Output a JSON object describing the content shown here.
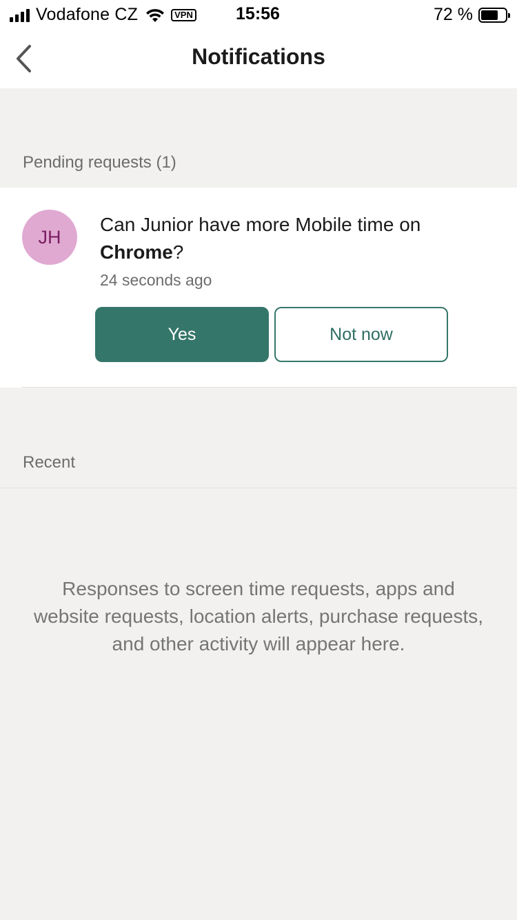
{
  "status_bar": {
    "carrier": "Vodafone CZ",
    "vpn": "VPN",
    "time": "15:56",
    "battery_percent": "72 %",
    "battery_level": 0.72
  },
  "nav": {
    "title": "Notifications",
    "back_icon": "chevron-left-icon"
  },
  "pending": {
    "header": "Pending requests (1)",
    "request": {
      "avatar_initials": "JH",
      "avatar_color": "#e0a9d2",
      "text_prefix": "Can Junior have more Mobile time on ",
      "app_name": "Chrome",
      "text_suffix": "?",
      "time_ago": "24 seconds ago",
      "yes_label": "Yes",
      "not_now_label": "Not now"
    }
  },
  "recent": {
    "header": "Recent",
    "empty_message": "Responses to screen time requests, apps and website requests, location alerts, purchase requests, and other activity will appear here."
  },
  "colors": {
    "accent": "#35766a",
    "background": "#f2f1ef"
  }
}
